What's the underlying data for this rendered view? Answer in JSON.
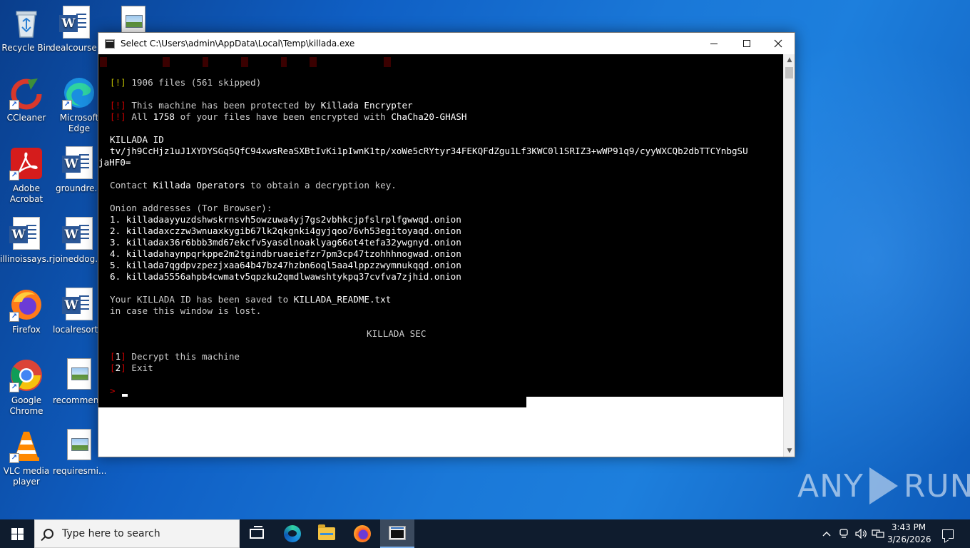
{
  "desktop": {
    "icons": [
      {
        "label": "Recycle Bin",
        "icon": "recycle-bin-icon"
      },
      {
        "label": "dealcourse...",
        "icon": "word-document-icon"
      },
      {
        "label": "",
        "icon": "image-file-icon"
      },
      {
        "label": "CCleaner",
        "icon": "ccleaner-icon"
      },
      {
        "label": "Microsoft Edge",
        "icon": "edge-icon"
      },
      {
        "label": "Adobe Acrobat",
        "icon": "acrobat-icon"
      },
      {
        "label": "groundre...",
        "icon": "word-document-icon"
      },
      {
        "label": "illinoissays.rtf",
        "icon": "word-document-icon"
      },
      {
        "label": "joineddog.r...",
        "icon": "word-document-icon"
      },
      {
        "label": "Firefox",
        "icon": "firefox-icon"
      },
      {
        "label": "localresort.r...",
        "icon": "word-document-icon"
      },
      {
        "label": "Google Chrome",
        "icon": "chrome-icon"
      },
      {
        "label": "recommen...",
        "icon": "image-file-icon"
      },
      {
        "label": "VLC media player",
        "icon": "vlc-icon"
      },
      {
        "label": "requiresmi...",
        "icon": "image-file-icon"
      }
    ]
  },
  "window": {
    "title": "Select C:\\Users\\admin\\AppData\\Local\\Temp\\killada.exe",
    "minimize_label": "—",
    "maximize_label": "☐",
    "close_label": "✕"
  },
  "console": {
    "files_bracket": "[!]",
    "files_line": " 1906 files (561 skipped)",
    "protected_bracket": "[!]",
    "protected_text": " This machine has been protected by ",
    "protected_name": "Killada Encrypter",
    "encrypted_bracket": "[!]",
    "encrypted_pre": " All ",
    "encrypted_count": "1758",
    "encrypted_mid": " of your files have been encrypted with ",
    "encrypted_algo": "ChaCha20-GHASH",
    "id_heading": "KILLADA ID",
    "id_value": "tv/jh9CcHjz1uJ1XYDYSGq5QfC94xwsReaSXBtIvKi1pIwnK1tp/xoWe5cRYtyr34FEKQFdZgu1Lf3KWC0l1SRIZ3+wWP91q9/cyyWXCQb2dbTTCYnbgSU",
    "id_value_rest": "jaHF0=",
    "contact_pre": "Contact ",
    "contact_name": "Killada Operators",
    "contact_post": " to obtain a decryption key.",
    "onion_heading": "Onion addresses (Tor Browser):",
    "onions": [
      "1. killadaayyuzdshwskrnsvh5owzuwa4yj7gs2vbhkcjpfslrplfgwwqd.onion",
      "2. killadaxczzw3wnuaxkygib67lk2qkgnki4gyjqoo76vh53egitoyaqd.onion",
      "3. killadax36r6bbb3md67ekcfv5yasdlnoaklyag66ot4tefa32ywgnyd.onion",
      "4. killadahaynpqrkppe2m2tgindbruaeiefzr7pm3cp47tzohhhnogwad.onion",
      "5. killada7qgdpvzpezjxaa64b47bz47hzbn6oql5aa4lppzzwymnukqqd.onion",
      "6. killada5556ahpb4cwmatv5qpzku2qmdlwawshtykpq37cvfva7zjhid.onion"
    ],
    "saved_pre": "Your KILLADA ID has been saved to ",
    "saved_file": "KILLADA_README.txt",
    "saved_post": "in case this window is lost.",
    "brand": "KILLADA SEC",
    "option1_num": "1",
    "option1_label": " Decrypt this machine",
    "option2_num": "2",
    "option2_label": " Exit",
    "prompt": ">"
  },
  "watermark": {
    "left": "ANY",
    "right": "RUN"
  },
  "taskbar": {
    "search_placeholder": "Type here to search",
    "apps": [
      "task-view-icon",
      "edge-icon",
      "file-explorer-icon",
      "firefox-icon",
      "console-icon"
    ]
  },
  "tray": {
    "time": "3:43 PM",
    "date": "3/26/2026"
  },
  "colors": {
    "desktop_blue": "#1565c0",
    "taskbar": "#0f1c2e",
    "console_bg": "#000000",
    "console_text": "#cccccc",
    "bracket_red": "#c40000",
    "bracket_yellow": "#b8b800"
  }
}
